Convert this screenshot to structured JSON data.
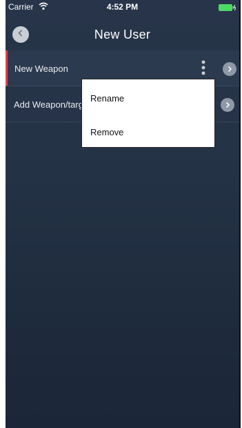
{
  "status_bar": {
    "carrier": "Carrier",
    "time": "4:52 PM",
    "wifi_icon": "wifi-icon",
    "battery_icon": "battery-charging-icon",
    "battery_color": "#4cd964"
  },
  "nav": {
    "title": "New User",
    "back_icon": "chevron-left-icon"
  },
  "list": {
    "items": [
      {
        "label": "New Weapon",
        "selected": true,
        "more_icon": "vertical-dots-icon",
        "chevron_icon": "chevron-right-icon"
      },
      {
        "label": "Add Weapon/targ",
        "selected": false,
        "chevron_icon": "chevron-right-icon"
      }
    ],
    "selected_accent": "#e0404f"
  },
  "popup_menu": {
    "items": [
      {
        "label": "Rename"
      },
      {
        "label": "Remove"
      }
    ]
  }
}
